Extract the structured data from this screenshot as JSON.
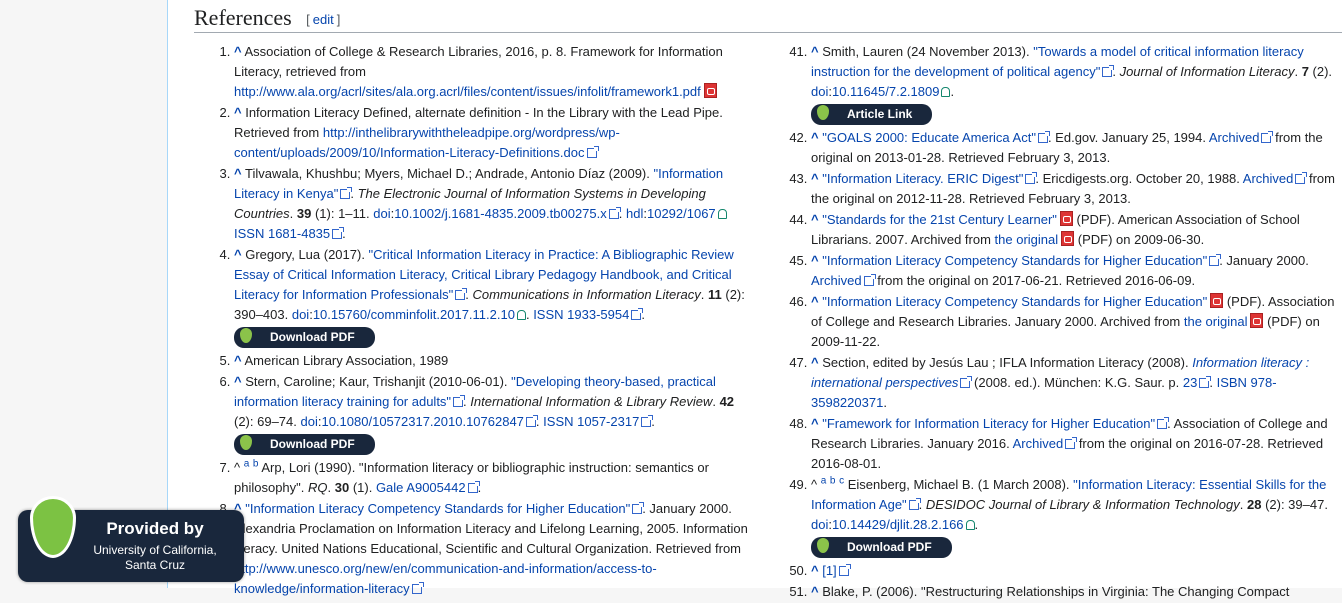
{
  "section": {
    "title": "References",
    "edit_open": "[",
    "edit_label": "edit",
    "edit_close": "]"
  },
  "icons": {
    "external": "external-link-icon",
    "pdf": "pdf-icon",
    "open_access": "open-access-lock-icon",
    "droplet": "droplet-logo-icon"
  },
  "colors": {
    "link": "#0645ad",
    "button_bg": "#19273c",
    "drop_green": "#7cc243"
  },
  "buttons": {
    "download_pdf": "Download PDF",
    "article_link": "Article Link"
  },
  "provided": {
    "title": "Provided by",
    "org": "University of California, Santa Cruz"
  },
  "refs": {
    "r1": {
      "a": "Association of College & Research Libraries, 2016, p. 8. Framework for Information Literacy, retrieved from ",
      "url": "http://www.ala.org/acrl/sites/ala.org.acrl/files/content/issues/infolit/framework1.pdf"
    },
    "r2": {
      "a": "Information Literacy Defined, alternate definition - In the Library with the Lead Pipe. Retrieved from ",
      "url": "http://inthelibrarywiththeleadpipe.org/wordpress/wp-content/uploads/2009/10/Information-Literacy-Definitions.doc"
    },
    "r3": {
      "a": "Tilvawala, Khushbu; Myers, Michael D.; Andrade, Antonio Díaz (2009). ",
      "title": "\"Information Literacy in Kenya\"",
      "b": ". ",
      "journal": "The Electronic Journal of Information Systems in Developing Countries",
      "c": ". ",
      "vol": "39",
      "d": " (1): 1–11. ",
      "doi_l": "doi",
      "doi": "10.1002/j.1681-4835.2009.tb00275.x",
      "e": ". ",
      "hdl_l": "hdl",
      "hdl": "10292/1067",
      "f": " ",
      "issn_l": "ISSN",
      "issn": "1681-4835",
      "g": "."
    },
    "r4": {
      "a": "Gregory, Lua (2017). ",
      "title": "\"Critical Information Literacy in Practice: A Bibliographic Review Essay of Critical Information Literacy, Critical Library Pedagogy Handbook, and Critical Literacy for Information Professionals\"",
      "b": ". ",
      "journal": "Communications in Information Literacy",
      "c": ". ",
      "vol": "11",
      "d": " (2): 390–403. ",
      "doi_l": "doi",
      "doi": "10.15760/comminfolit.2017.11.2.10",
      "e": ". ",
      "issn_l": "ISSN",
      "issn": "1933-5954",
      "f": "."
    },
    "r5": {
      "a": "American Library Association, 1989"
    },
    "r6": {
      "a": "Stern, Caroline; Kaur, Trishanjit (2010-06-01). ",
      "title": "\"Developing theory-based, practical information literacy training for adults\"",
      "b": ". ",
      "journal": "International Information & Library Review",
      "c": ". ",
      "vol": "42",
      "d": " (2): 69–74. ",
      "doi_l": "doi",
      "doi": "10.1080/10572317.2010.10762847",
      "e": ". ",
      "issn_l": "ISSN",
      "issn": "1057-2317",
      "f": "."
    },
    "r7": {
      "caret": "^",
      "sa": "a",
      "sb": "b",
      "a": " Arp, Lori (1990). \"Information literacy or bibliographic instruction: semantics or philosophy\". ",
      "journal": "RQ",
      "b": ". ",
      "vol": "30",
      "c": " (1). ",
      "gale": "Gale A9005442",
      "d": "."
    },
    "r8": {
      "title": "\"Information Literacy Competency Standards for Higher Education\"",
      "a": ". January 2000.",
      "line2": "Alexandria Proclamation on Information Literacy and Lifelong Learning, 2005. Information literacy. United Nations Educational, Scientific and Cultural Organization. Retrieved from ",
      "url": "http://www.unesco.org/new/en/communication-and-information/access-to-knowledge/information-literacy"
    },
    "r41": {
      "a": "Smith, Lauren (24 November 2013). ",
      "title": "\"Towards a model of critical information literacy instruction for the development of political agency\"",
      "b": ". ",
      "journal": "Journal of Information Literacy",
      "c": ". ",
      "vol": "7",
      "d": " (2). ",
      "doi_l": "doi",
      "doi": "10.11645/7.2.1809",
      "e": "."
    },
    "r42": {
      "title": "\"GOALS 2000: Educate America Act\"",
      "a": ". Ed.gov. January 25, 1994. ",
      "arch": "Archived",
      "b": " from the original on 2013-01-28. Retrieved February 3, 2013."
    },
    "r43": {
      "title": "\"Information Literacy. ERIC Digest\"",
      "a": ". Ericdigests.org. October 20, 1988. ",
      "arch": "Archived",
      "b": " from the original on 2012-11-28. Retrieved February 3, 2013."
    },
    "r44": {
      "title": "\"Standards for the 21st Century Learner\"",
      "a": " (PDF). American Association of School Librarians. 2007. Archived from ",
      "orig": "the original",
      "b": " (PDF) on 2009-06-30."
    },
    "r45": {
      "title": "\"Information Literacy Competency Standards for Higher Education\"",
      "a": ". January 2000. ",
      "arch": "Archived",
      "b": " from the original on 2017-06-21. Retrieved 2016-06-09."
    },
    "r46": {
      "title": "\"Information Literacy Competency Standards for Higher Education\"",
      "a": " (PDF). Association of College and Research Libraries. January 2000. Archived from ",
      "orig": "the original",
      "b": " (PDF) on 2009-11-22."
    },
    "r47": {
      "a": "Section, edited by Jesús Lau ; IFLA Information Literacy (2008). ",
      "title": "Information literacy : international perspectives",
      "b": " (2008. ed.). München: K.G. Saur. p. ",
      "page": "23",
      "c": ". ",
      "isbn": "ISBN 978-3598220371",
      "d": "."
    },
    "r48": {
      "title": "\"Framework for Information Literacy for Higher Education\"",
      "a": ". Association of College and Research Libraries. January 2016. ",
      "arch": "Archived",
      "b": " from the original on 2016-07-28. Retrieved 2016-08-01."
    },
    "r49": {
      "caret": "^",
      "sa": "a",
      "sb": "b",
      "sc": "c",
      "a": " Eisenberg, Michael B. (1 March 2008). ",
      "title": "\"Information Literacy: Essential Skills for the Information Age\"",
      "b": ". ",
      "journal": "DESIDOC Journal of Library & Information Technology",
      "c": ". ",
      "vol": "28",
      "d": " (2): 39–47. ",
      "doi_l": "doi",
      "doi": "10.14429/djlit.28.2.166",
      "e": "."
    },
    "r50": {
      "link": "[1]"
    },
    "r51": {
      "a": "Blake, P. (2006). \"Restructuring Relationships in Virginia: The Changing Compact"
    }
  }
}
